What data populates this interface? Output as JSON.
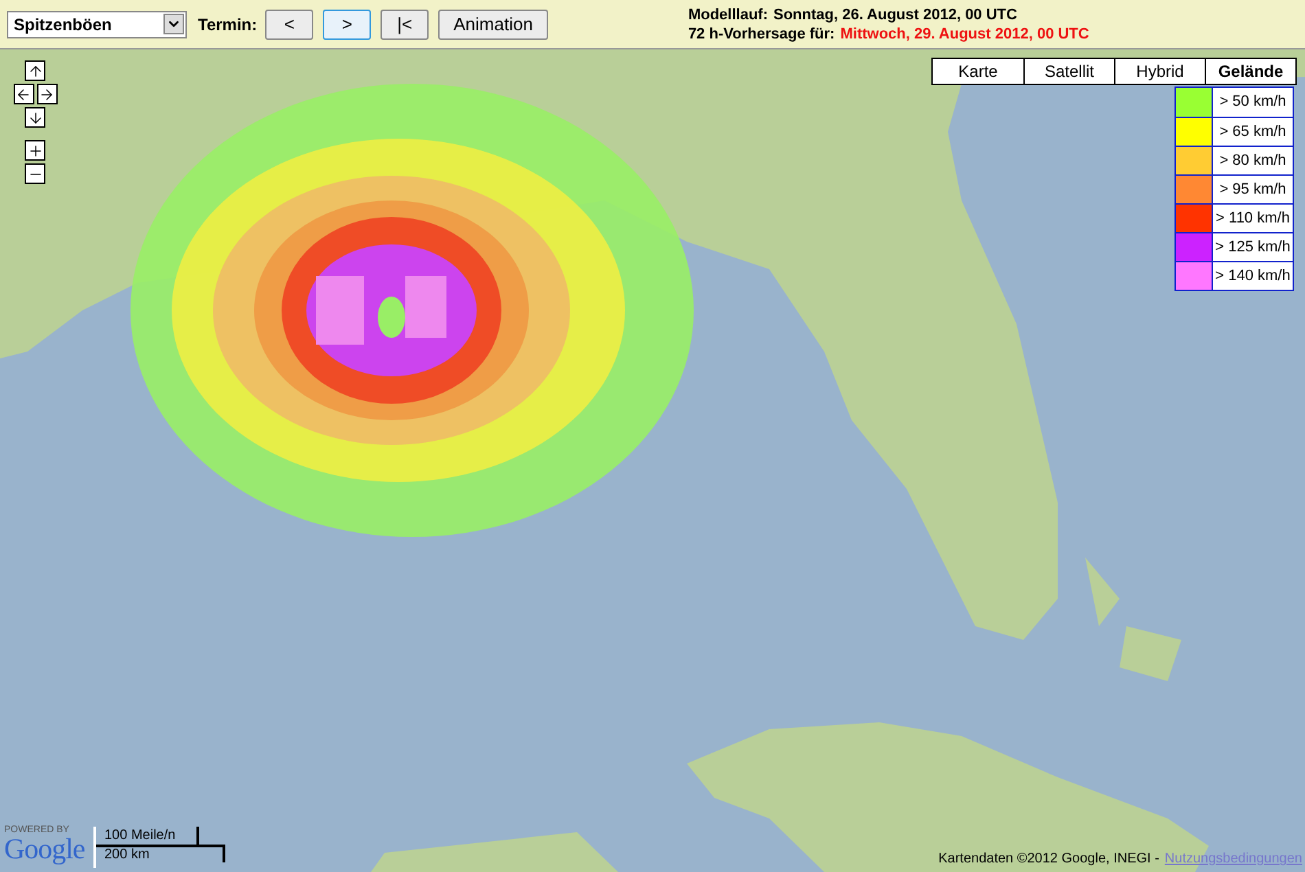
{
  "toolbar": {
    "parameter_select": {
      "value": "Spitzenböen"
    },
    "termin_label": "Termin:",
    "buttons": [
      {
        "label": "<",
        "selected": false
      },
      {
        "label": ">",
        "selected": true
      },
      {
        "label": "|<",
        "selected": false
      },
      {
        "label": "Animation",
        "selected": false
      }
    ]
  },
  "run_info": {
    "model_run_label": "Modelllauf:",
    "model_run": "Sonntag, 26. August 2012, 00 UTC",
    "forecast_label": "72 h-Vorhersage für:",
    "forecast_date": "Mittwoch, 29. August 2012, 00 UTC"
  },
  "map": {
    "map_types": [
      {
        "label": "Karte",
        "selected": false
      },
      {
        "label": "Satellit",
        "selected": false
      },
      {
        "label": "Hybrid",
        "selected": false
      },
      {
        "label": "Gelände",
        "selected": true
      }
    ],
    "legend": [
      {
        "color": "#99ff33",
        "label": "> 50 km/h"
      },
      {
        "color": "#ffff00",
        "label": "> 65 km/h"
      },
      {
        "color": "#ffcc33",
        "label": "> 80 km/h"
      },
      {
        "color": "#ff8833",
        "label": "> 95 km/h"
      },
      {
        "color": "#ff3300",
        "label": "> 110 km/h"
      },
      {
        "color": "#cc22ff",
        "label": "> 125 km/h"
      },
      {
        "color": "#ff77ff",
        "label": "> 140 km/h"
      }
    ],
    "powered_by": "POWERED BY",
    "logo": "Google",
    "scale": {
      "imperial": "100 Meile/n",
      "metric": "200 km"
    },
    "attribution": "Kartendaten ©2012 Google, INEGI -",
    "terms_link": "Nutzungsbedingungen"
  }
}
